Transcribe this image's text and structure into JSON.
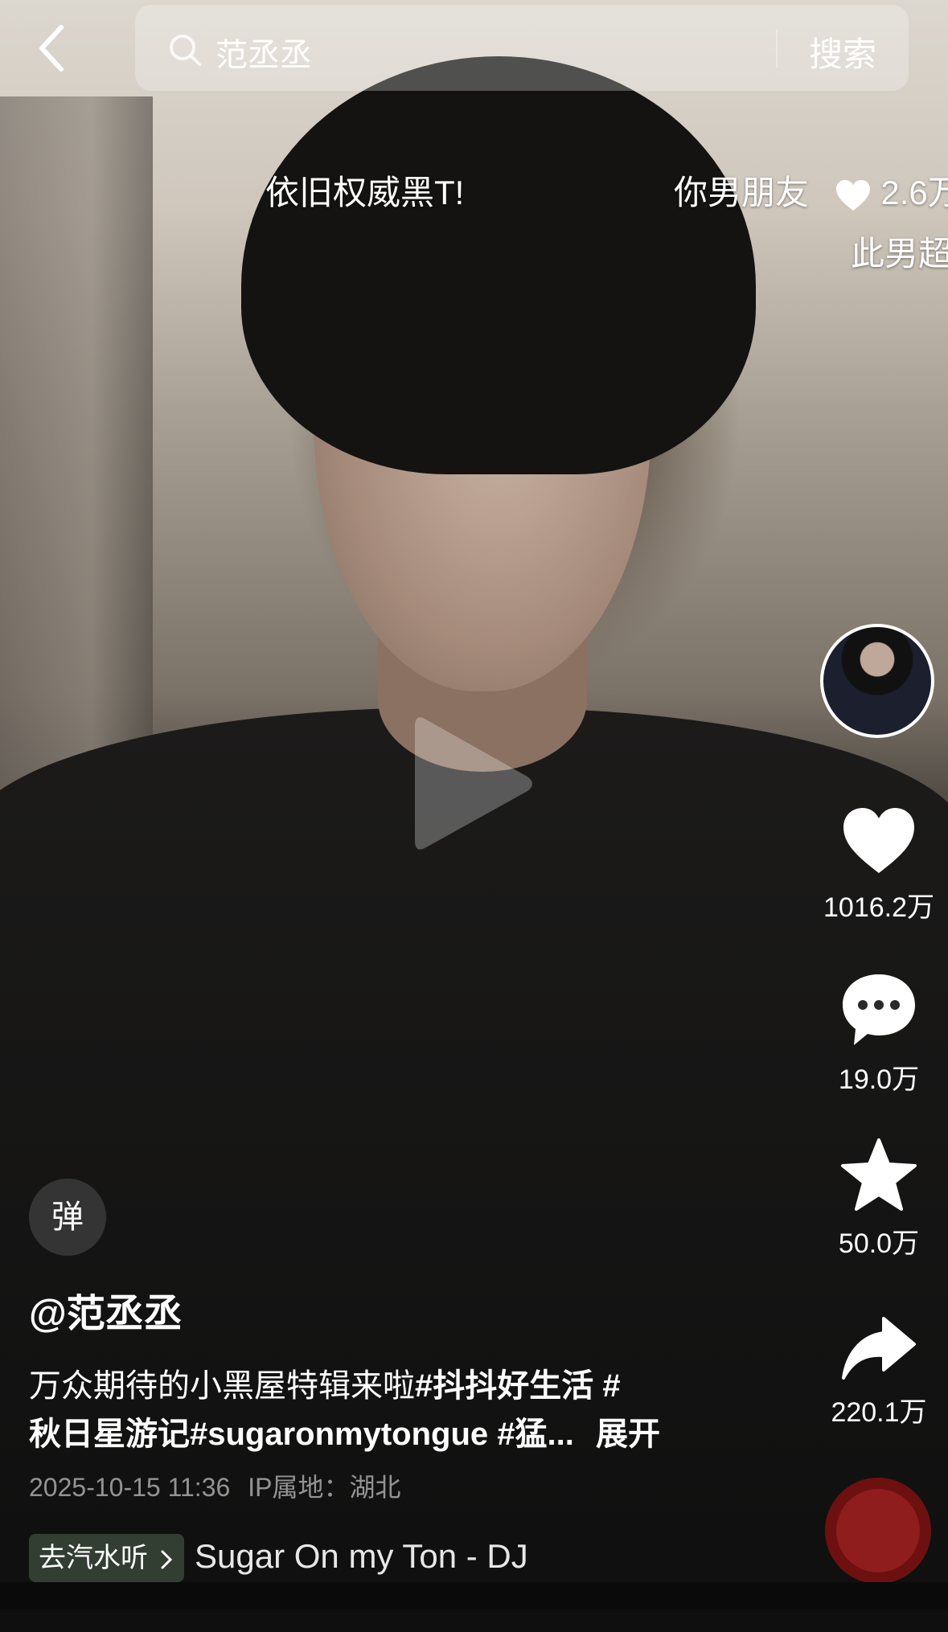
{
  "search": {
    "query": "范丞丞",
    "button": "搜索"
  },
  "danmaku": [
    {
      "text": "依旧权威黑T!"
    },
    {
      "text": "你男朋友",
      "likes": "2.6万"
    },
    {
      "text": "此男超"
    }
  ],
  "rail": {
    "likes": "1016.2万",
    "comments": "19.0万",
    "favorites": "50.0万",
    "shares": "220.1万",
    "icons": [
      "avatar",
      "heart-icon",
      "comment-icon",
      "star-icon",
      "share-icon",
      "music-disc"
    ]
  },
  "video": {
    "danmaku_toggle": "弹",
    "author": "@范丞丞",
    "desc_plain1": "万众期待的小黑屋特辑来啦",
    "desc_tag1": "#抖抖好生活 #",
    "desc_tag2": "秋日星游记#sugaronmytongue #猛...",
    "desc_more": "展开",
    "date": "2025-10-15 11:36",
    "ip": "IP属地：湖北"
  },
  "music": {
    "chip": "去汽水听",
    "title": "Sugar On my Ton - DJ"
  },
  "colors": {
    "overlay": "#ffffff",
    "meta": "#bdbdbd",
    "chip": "#374637",
    "disc": "#a71f1f"
  }
}
